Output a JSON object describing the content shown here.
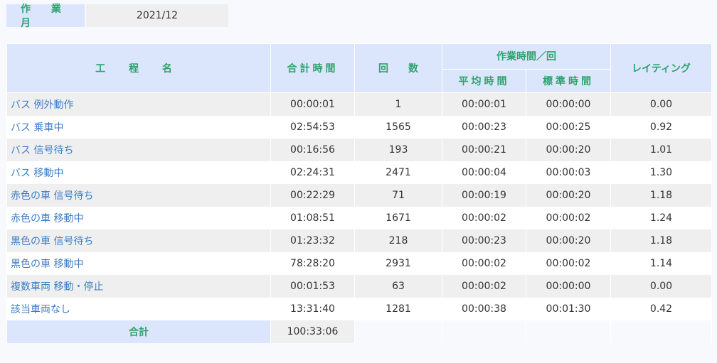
{
  "month": {
    "label": "作 業 月",
    "value": "2021/12"
  },
  "table": {
    "headers": {
      "process_name": "工 程 名",
      "total_time": "合計時間",
      "count": "回　　数",
      "time_per_cycle": "作業時間／回",
      "avg_time": "平均時間",
      "std_time": "標準時間",
      "rating": "レイティング"
    },
    "rows": [
      {
        "name": "バス 例外動作",
        "total": "00:00:01",
        "count": "1",
        "avg": "00:00:01",
        "std": "00:00:00",
        "rating": "0.00"
      },
      {
        "name": "バス 乗車中",
        "total": "02:54:53",
        "count": "1565",
        "avg": "00:00:23",
        "std": "00:00:25",
        "rating": "0.92"
      },
      {
        "name": "バス 信号待ち",
        "total": "00:16:56",
        "count": "193",
        "avg": "00:00:21",
        "std": "00:00:20",
        "rating": "1.01"
      },
      {
        "name": "バス 移動中",
        "total": "02:24:31",
        "count": "2471",
        "avg": "00:00:04",
        "std": "00:00:03",
        "rating": "1.30"
      },
      {
        "name": "赤色の車 信号待ち",
        "total": "00:22:29",
        "count": "71",
        "avg": "00:00:19",
        "std": "00:00:20",
        "rating": "1.18"
      },
      {
        "name": "赤色の車 移動中",
        "total": "01:08:51",
        "count": "1671",
        "avg": "00:00:02",
        "std": "00:00:02",
        "rating": "1.24"
      },
      {
        "name": "黒色の車 信号待ち",
        "total": "01:23:32",
        "count": "218",
        "avg": "00:00:23",
        "std": "00:00:20",
        "rating": "1.18"
      },
      {
        "name": "黒色の車 移動中",
        "total": "78:28:20",
        "count": "2931",
        "avg": "00:00:02",
        "std": "00:00:02",
        "rating": "1.14"
      },
      {
        "name": "複数車両 移動・停止",
        "total": "00:01:53",
        "count": "63",
        "avg": "00:00:02",
        "std": "00:00:00",
        "rating": "0.00"
      },
      {
        "name": "該当車両なし",
        "total": "13:31:40",
        "count": "1281",
        "avg": "00:00:38",
        "std": "00:01:30",
        "rating": "0.42"
      }
    ],
    "total": {
      "label": "合計",
      "value": "100:33:06"
    }
  },
  "colors": {
    "header_bg": "#dbe6fd",
    "header_text": "#2ea36c",
    "link_text": "#3d7dc8",
    "row_alt_bg": "#efefef"
  }
}
